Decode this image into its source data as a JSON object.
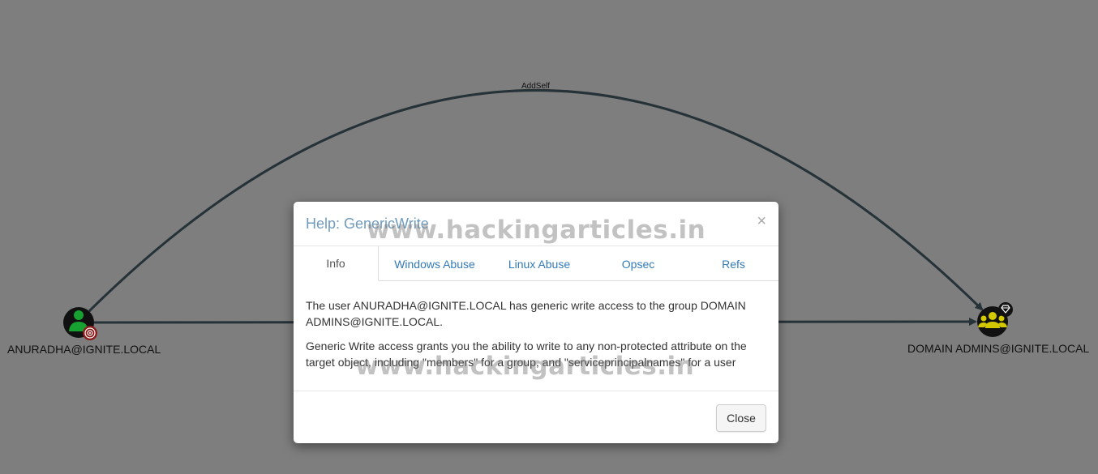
{
  "graph": {
    "edge_arc_label": "AddSelf",
    "source_node": {
      "label": "ANURADHA@IGNITE.LOCAL",
      "icon": "user-icon",
      "badge": "target-icon",
      "color": "#17a130"
    },
    "target_node": {
      "label": "DOMAIN ADMINS@IGNITE.LOCAL",
      "icon": "group-icon",
      "badge": "gem-icon",
      "color": "#d4c900"
    },
    "edge_color": "#253238"
  },
  "modal": {
    "title": "Help: GenericWrite",
    "close_x": "×",
    "tabs": [
      {
        "label": "Info",
        "active": true
      },
      {
        "label": "Windows Abuse",
        "active": false
      },
      {
        "label": "Linux Abuse",
        "active": false
      },
      {
        "label": "Opsec",
        "active": false
      },
      {
        "label": "Refs",
        "active": false
      }
    ],
    "body": {
      "paragraph1": "The user ANURADHA@IGNITE.LOCAL has generic write access to the group DOMAIN ADMINS@IGNITE.LOCAL.",
      "paragraph2": "Generic Write access grants you the ability to write to any non-protected attribute on the target object, including \"members\" for a group, and \"serviceprincipalnames\" for a user"
    },
    "close_button": "Close"
  },
  "watermark": "www.hackingarticles.in"
}
